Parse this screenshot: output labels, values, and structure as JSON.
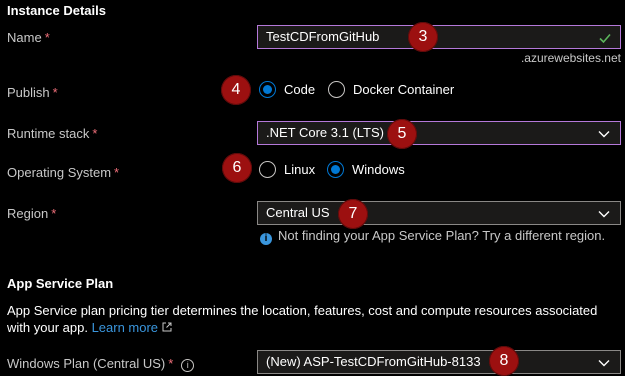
{
  "instance": {
    "heading": "Instance Details",
    "name": {
      "label": "Name",
      "required": "*",
      "value": "TestCDFromGitHub",
      "badge": "3",
      "suffix": ".azurewebsites.net"
    },
    "publish": {
      "label": "Publish",
      "required": "*",
      "badge": "4",
      "options": [
        "Code",
        "Docker Container"
      ],
      "selected": "Code"
    },
    "runtime": {
      "label": "Runtime stack",
      "required": "*",
      "value": ".NET Core 3.1 (LTS)",
      "badge": "5"
    },
    "os": {
      "label": "Operating System",
      "required": "*",
      "badge": "6",
      "options": [
        "Linux",
        "Windows"
      ],
      "selected": "Windows"
    },
    "region": {
      "label": "Region",
      "required": "*",
      "value": "Central US",
      "badge": "7",
      "info_text": "Not finding your App Service Plan? Try a different region."
    }
  },
  "plan": {
    "heading": "App Service Plan",
    "description": "App Service plan pricing tier determines the location, features, cost and compute resources associated with your app.",
    "learn_more": "Learn more",
    "windows_plan": {
      "label": "Windows Plan (Central US)",
      "required": "*",
      "value": "(New) ASP-TestCDFromGitHub-8133",
      "badge": "8"
    }
  },
  "colors": {
    "accent": "#0078d4",
    "badge": "#9c1010",
    "required": "#f1707b",
    "focus": "#b478d9"
  }
}
